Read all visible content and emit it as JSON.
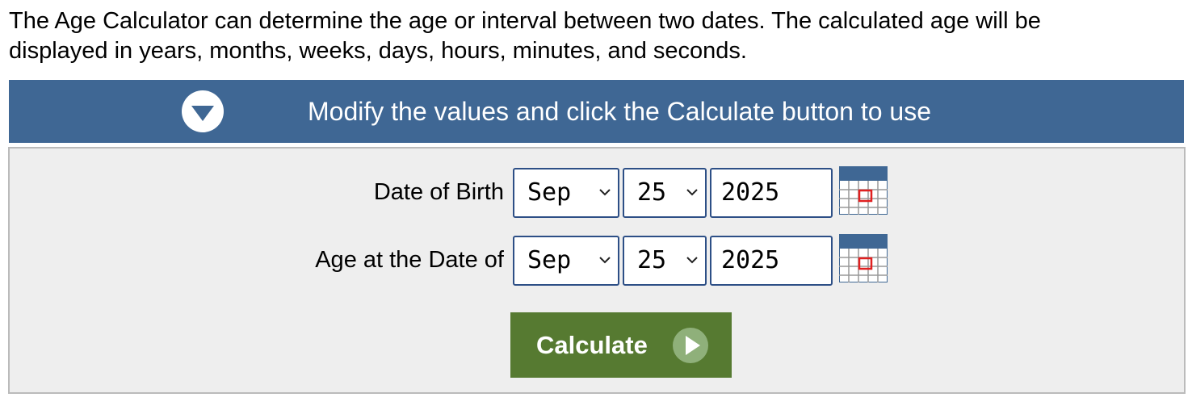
{
  "intro": {
    "line1": "The Age Calculator can determine the age or interval between two dates. The calculated age will be",
    "line2": "displayed in years, months, weeks, days, hours, minutes, and seconds."
  },
  "banner": {
    "title": "Modify the values and click the Calculate button to use",
    "toggle_icon": "chevron-down-circle-icon"
  },
  "form": {
    "birth": {
      "label": "Date of Birth",
      "month": "Sep",
      "day": "25",
      "year": "2025"
    },
    "age_at": {
      "label": "Age at the Date of",
      "month": "Sep",
      "day": "25",
      "year": "2025"
    },
    "calendar_icon": "calendar-icon"
  },
  "calculate": {
    "label": "Calculate",
    "icon": "play-circle-icon"
  },
  "colors": {
    "banner": "#3f6794",
    "panel": "#eeeeee",
    "button": "#567a31",
    "input_border": "#2d4f86"
  }
}
